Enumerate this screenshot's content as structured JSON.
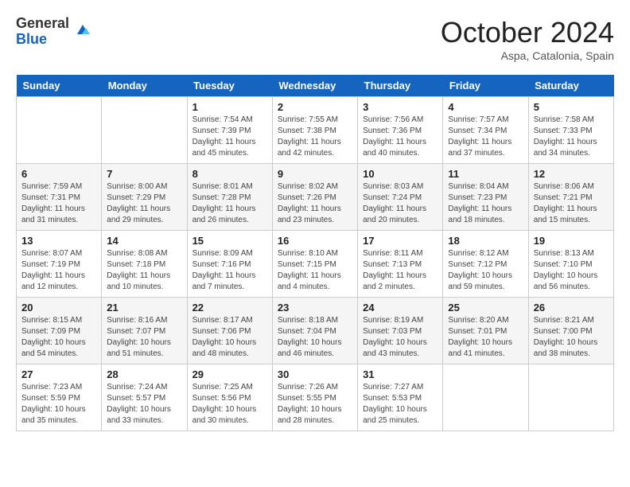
{
  "header": {
    "logo_general": "General",
    "logo_blue": "Blue",
    "title": "October 2024",
    "subtitle": "Aspa, Catalonia, Spain"
  },
  "columns": [
    "Sunday",
    "Monday",
    "Tuesday",
    "Wednesday",
    "Thursday",
    "Friday",
    "Saturday"
  ],
  "weeks": [
    [
      {
        "day": "",
        "sunrise": "",
        "sunset": "",
        "daylight": ""
      },
      {
        "day": "",
        "sunrise": "",
        "sunset": "",
        "daylight": ""
      },
      {
        "day": "1",
        "sunrise": "Sunrise: 7:54 AM",
        "sunset": "Sunset: 7:39 PM",
        "daylight": "Daylight: 11 hours and 45 minutes."
      },
      {
        "day": "2",
        "sunrise": "Sunrise: 7:55 AM",
        "sunset": "Sunset: 7:38 PM",
        "daylight": "Daylight: 11 hours and 42 minutes."
      },
      {
        "day": "3",
        "sunrise": "Sunrise: 7:56 AM",
        "sunset": "Sunset: 7:36 PM",
        "daylight": "Daylight: 11 hours and 40 minutes."
      },
      {
        "day": "4",
        "sunrise": "Sunrise: 7:57 AM",
        "sunset": "Sunset: 7:34 PM",
        "daylight": "Daylight: 11 hours and 37 minutes."
      },
      {
        "day": "5",
        "sunrise": "Sunrise: 7:58 AM",
        "sunset": "Sunset: 7:33 PM",
        "daylight": "Daylight: 11 hours and 34 minutes."
      }
    ],
    [
      {
        "day": "6",
        "sunrise": "Sunrise: 7:59 AM",
        "sunset": "Sunset: 7:31 PM",
        "daylight": "Daylight: 11 hours and 31 minutes."
      },
      {
        "day": "7",
        "sunrise": "Sunrise: 8:00 AM",
        "sunset": "Sunset: 7:29 PM",
        "daylight": "Daylight: 11 hours and 29 minutes."
      },
      {
        "day": "8",
        "sunrise": "Sunrise: 8:01 AM",
        "sunset": "Sunset: 7:28 PM",
        "daylight": "Daylight: 11 hours and 26 minutes."
      },
      {
        "day": "9",
        "sunrise": "Sunrise: 8:02 AM",
        "sunset": "Sunset: 7:26 PM",
        "daylight": "Daylight: 11 hours and 23 minutes."
      },
      {
        "day": "10",
        "sunrise": "Sunrise: 8:03 AM",
        "sunset": "Sunset: 7:24 PM",
        "daylight": "Daylight: 11 hours and 20 minutes."
      },
      {
        "day": "11",
        "sunrise": "Sunrise: 8:04 AM",
        "sunset": "Sunset: 7:23 PM",
        "daylight": "Daylight: 11 hours and 18 minutes."
      },
      {
        "day": "12",
        "sunrise": "Sunrise: 8:06 AM",
        "sunset": "Sunset: 7:21 PM",
        "daylight": "Daylight: 11 hours and 15 minutes."
      }
    ],
    [
      {
        "day": "13",
        "sunrise": "Sunrise: 8:07 AM",
        "sunset": "Sunset: 7:19 PM",
        "daylight": "Daylight: 11 hours and 12 minutes."
      },
      {
        "day": "14",
        "sunrise": "Sunrise: 8:08 AM",
        "sunset": "Sunset: 7:18 PM",
        "daylight": "Daylight: 11 hours and 10 minutes."
      },
      {
        "day": "15",
        "sunrise": "Sunrise: 8:09 AM",
        "sunset": "Sunset: 7:16 PM",
        "daylight": "Daylight: 11 hours and 7 minutes."
      },
      {
        "day": "16",
        "sunrise": "Sunrise: 8:10 AM",
        "sunset": "Sunset: 7:15 PM",
        "daylight": "Daylight: 11 hours and 4 minutes."
      },
      {
        "day": "17",
        "sunrise": "Sunrise: 8:11 AM",
        "sunset": "Sunset: 7:13 PM",
        "daylight": "Daylight: 11 hours and 2 minutes."
      },
      {
        "day": "18",
        "sunrise": "Sunrise: 8:12 AM",
        "sunset": "Sunset: 7:12 PM",
        "daylight": "Daylight: 10 hours and 59 minutes."
      },
      {
        "day": "19",
        "sunrise": "Sunrise: 8:13 AM",
        "sunset": "Sunset: 7:10 PM",
        "daylight": "Daylight: 10 hours and 56 minutes."
      }
    ],
    [
      {
        "day": "20",
        "sunrise": "Sunrise: 8:15 AM",
        "sunset": "Sunset: 7:09 PM",
        "daylight": "Daylight: 10 hours and 54 minutes."
      },
      {
        "day": "21",
        "sunrise": "Sunrise: 8:16 AM",
        "sunset": "Sunset: 7:07 PM",
        "daylight": "Daylight: 10 hours and 51 minutes."
      },
      {
        "day": "22",
        "sunrise": "Sunrise: 8:17 AM",
        "sunset": "Sunset: 7:06 PM",
        "daylight": "Daylight: 10 hours and 48 minutes."
      },
      {
        "day": "23",
        "sunrise": "Sunrise: 8:18 AM",
        "sunset": "Sunset: 7:04 PM",
        "daylight": "Daylight: 10 hours and 46 minutes."
      },
      {
        "day": "24",
        "sunrise": "Sunrise: 8:19 AM",
        "sunset": "Sunset: 7:03 PM",
        "daylight": "Daylight: 10 hours and 43 minutes."
      },
      {
        "day": "25",
        "sunrise": "Sunrise: 8:20 AM",
        "sunset": "Sunset: 7:01 PM",
        "daylight": "Daylight: 10 hours and 41 minutes."
      },
      {
        "day": "26",
        "sunrise": "Sunrise: 8:21 AM",
        "sunset": "Sunset: 7:00 PM",
        "daylight": "Daylight: 10 hours and 38 minutes."
      }
    ],
    [
      {
        "day": "27",
        "sunrise": "Sunrise: 7:23 AM",
        "sunset": "Sunset: 5:59 PM",
        "daylight": "Daylight: 10 hours and 35 minutes."
      },
      {
        "day": "28",
        "sunrise": "Sunrise: 7:24 AM",
        "sunset": "Sunset: 5:57 PM",
        "daylight": "Daylight: 10 hours and 33 minutes."
      },
      {
        "day": "29",
        "sunrise": "Sunrise: 7:25 AM",
        "sunset": "Sunset: 5:56 PM",
        "daylight": "Daylight: 10 hours and 30 minutes."
      },
      {
        "day": "30",
        "sunrise": "Sunrise: 7:26 AM",
        "sunset": "Sunset: 5:55 PM",
        "daylight": "Daylight: 10 hours and 28 minutes."
      },
      {
        "day": "31",
        "sunrise": "Sunrise: 7:27 AM",
        "sunset": "Sunset: 5:53 PM",
        "daylight": "Daylight: 10 hours and 25 minutes."
      },
      {
        "day": "",
        "sunrise": "",
        "sunset": "",
        "daylight": ""
      },
      {
        "day": "",
        "sunrise": "",
        "sunset": "",
        "daylight": ""
      }
    ]
  ]
}
